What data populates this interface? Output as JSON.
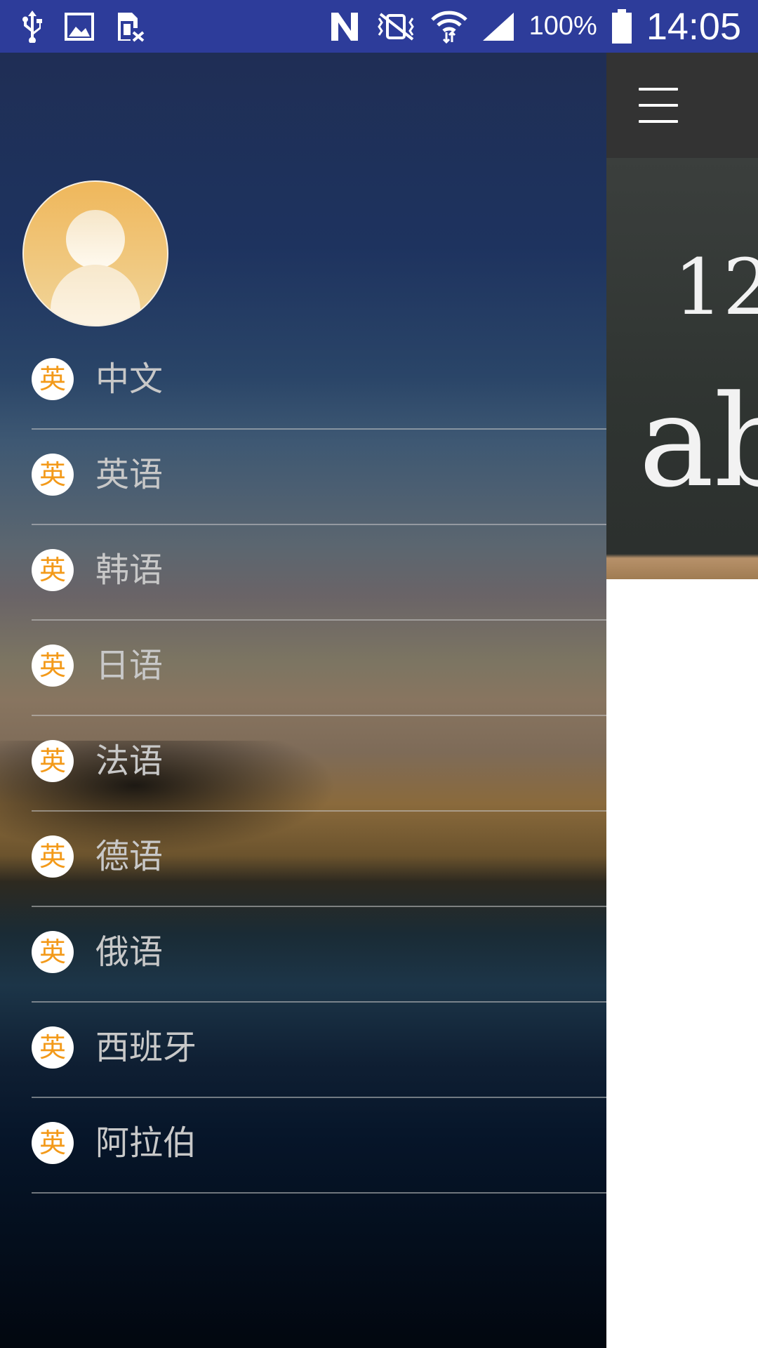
{
  "status_bar": {
    "battery": "100%",
    "time": "14:05",
    "icons": [
      "usb-icon",
      "image-icon",
      "sim-off-icon",
      "nfc-icon",
      "vibrate-icon",
      "wifi-icon",
      "signal-icon",
      "battery-icon"
    ]
  },
  "toolbar": {
    "menu_icon": "hamburger-menu-icon"
  },
  "banner": {
    "text_top": "12",
    "text_bottom": "ab"
  },
  "drawer": {
    "avatar_icon": "user-avatar-icon",
    "items": [
      {
        "badge": "英",
        "label": "中文"
      },
      {
        "badge": "英",
        "label": "英语"
      },
      {
        "badge": "英",
        "label": "韩语"
      },
      {
        "badge": "英",
        "label": "日语"
      },
      {
        "badge": "英",
        "label": "法语"
      },
      {
        "badge": "英",
        "label": "德语"
      },
      {
        "badge": "英",
        "label": "俄语"
      },
      {
        "badge": "英",
        "label": "西班牙"
      },
      {
        "badge": "英",
        "label": "阿拉伯"
      }
    ]
  },
  "colors": {
    "status_bar": "#2d3c9a",
    "toolbar": "#333333",
    "badge_text": "#f39a1a",
    "label_text": "#c8c8c8"
  }
}
